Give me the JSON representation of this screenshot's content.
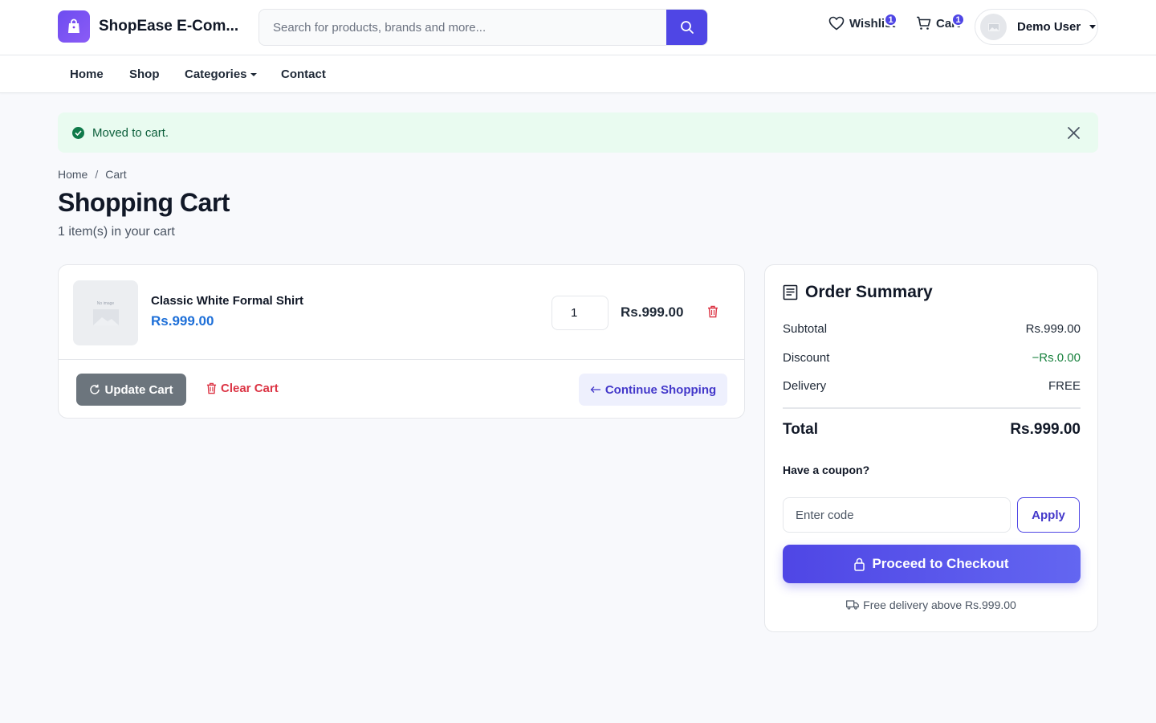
{
  "header": {
    "brand": "ShopEase E-Com...",
    "search_placeholder": "Search for products, brands and more...",
    "wishlist_label": "Wishlist",
    "wishlist_count": "1",
    "cart_label": "Cart",
    "cart_count": "1",
    "user_name": "Demo User"
  },
  "nav": {
    "home": "Home",
    "shop": "Shop",
    "categories": "Categories",
    "contact": "Contact"
  },
  "alert": {
    "message": "Moved to cart."
  },
  "breadcrumb": {
    "home": "Home",
    "separator": "/",
    "current": "Cart"
  },
  "page": {
    "title": "Shopping Cart",
    "subtitle": "1 item(s) in your cart"
  },
  "cart": {
    "items": [
      {
        "image_placeholder": "No image",
        "name": "Classic White Formal Shirt",
        "price": "Rs.999.00",
        "quantity": "1",
        "line_total": "Rs.999.00"
      }
    ],
    "update_label": "Update Cart",
    "clear_label": "Clear Cart",
    "continue_label": "Continue Shopping"
  },
  "summary": {
    "title": "Order Summary",
    "subtotal_label": "Subtotal",
    "subtotal_value": "Rs.999.00",
    "discount_label": "Discount",
    "discount_value": "−Rs.0.00",
    "delivery_label": "Delivery",
    "delivery_value": "FREE",
    "total_label": "Total",
    "total_value": "Rs.999.00",
    "coupon_label": "Have a coupon?",
    "coupon_placeholder": "Enter code",
    "apply_label": "Apply",
    "checkout_label": "Proceed to Checkout",
    "delivery_note": "Free delivery above Rs.999.00"
  },
  "colors": {
    "accent": "#4f46e5",
    "price_blue": "#1d6fd8",
    "danger": "#dc3545",
    "success_bg": "#e9fbf0",
    "success_text": "#0b5e3a"
  }
}
